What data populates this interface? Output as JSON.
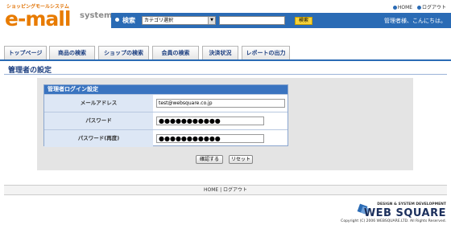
{
  "brand": {
    "tagline": "ショッピングモールシステム",
    "logo": "e-mall",
    "system": "system"
  },
  "toplinks": {
    "home": "HOME",
    "logout": "ログアウト"
  },
  "search": {
    "label": "検索",
    "category": "カテゴリ選択",
    "button": "検索",
    "greeting": "管理者様、こんにちは。"
  },
  "tabs": [
    "トップページ",
    "商品の検索",
    "ショップの検索",
    "会員の検索",
    "決済状況",
    "レポートの出力"
  ],
  "page": {
    "title": "管理者の設定"
  },
  "form": {
    "heading": "管理者ログイン設定",
    "fields": [
      {
        "label": "メールアドレス",
        "value": "test@websquare.co.jp"
      },
      {
        "label": "パスワード",
        "value": "●●●●●●●●●●●"
      },
      {
        "label": "パスワード(再度)",
        "value": "●●●●●●●●●●●"
      }
    ],
    "confirm": "確認する",
    "reset": "リセット"
  },
  "footer": {
    "links": "HOME | ログアウト"
  },
  "company": {
    "tag": "DESIGN & SYSTEM DEVELOPMENT",
    "name": "WEB SQUARE",
    "copyright": "Copyright (C) 2006 WEBSQUARE.LTD. All Rights Reserved."
  },
  "colors": {
    "brand_orange": "#e87b00",
    "nav_blue": "#2a6bb5",
    "search_btn": "#f6d23a"
  }
}
